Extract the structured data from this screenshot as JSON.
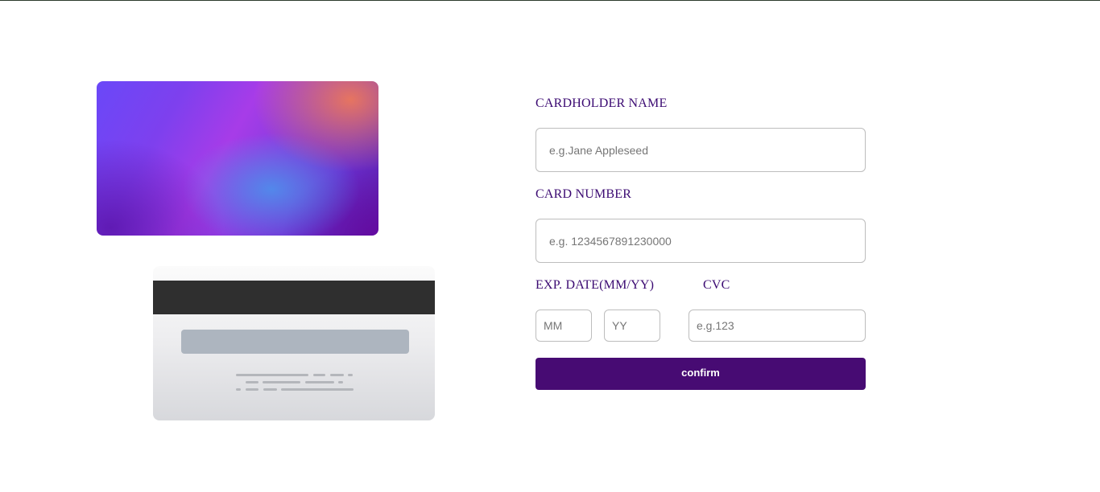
{
  "form": {
    "cardholder_label": "CARDHOLDER NAME",
    "cardholder_placeholder": "e.g.Jane Appleseed",
    "number_label": "CARD NUMBER",
    "number_placeholder": "e.g. 1234567891230000",
    "exp_label": "EXP. DATE(MM/YY)",
    "month_placeholder": "MM",
    "year_placeholder": "YY",
    "cvc_label": "CVC",
    "cvc_placeholder": "e.g.123",
    "confirm_label": "confirm"
  },
  "colors": {
    "accent": "#470b73",
    "label": "#3b0a72",
    "input_border": "#bdbdbd",
    "magnetic_stripe": "#2f2f2f",
    "signature_strip": "#adb5bf"
  }
}
